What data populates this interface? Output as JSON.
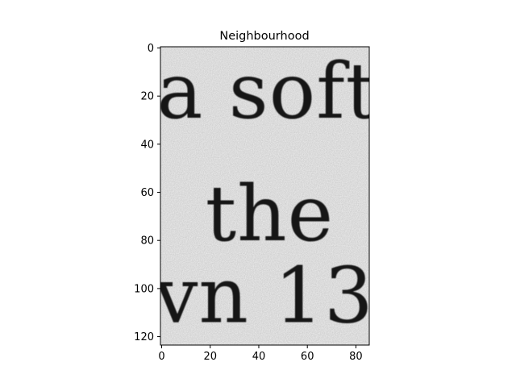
{
  "chart_data": {
    "type": "image",
    "title": "Neighbourhood",
    "colormap": "gray",
    "xlim": [
      -0.5,
      85.5
    ],
    "ylim": [
      123.5,
      -0.5
    ],
    "y_inverted": true,
    "xticks": [
      0,
      20,
      40,
      60,
      80
    ],
    "yticks": [
      0,
      20,
      40,
      60,
      80,
      100,
      120
    ],
    "xtick_labels": [
      "0",
      "20",
      "40",
      "60",
      "80"
    ],
    "ytick_labels": [
      "0",
      "20",
      "40",
      "60",
      "80",
      "100",
      "120"
    ],
    "image_text_lines": [
      {
        "text": "a soft",
        "x": -2,
        "y": 29
      },
      {
        "text": "the",
        "x": 18,
        "y": 80
      },
      {
        "text": "vn 13",
        "x": -3,
        "y": 114
      }
    ],
    "background_color": "#f1f1f1",
    "ink_color": "#161616",
    "frame_color": "#000000"
  }
}
